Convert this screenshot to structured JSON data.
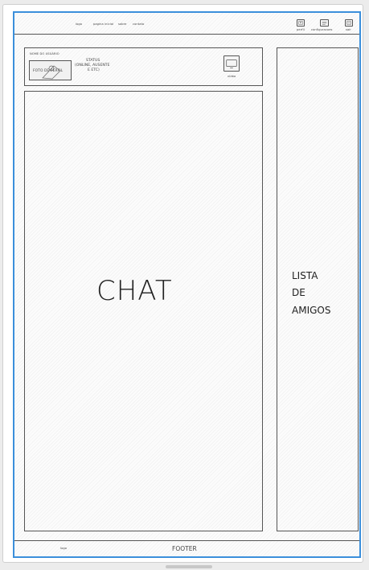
{
  "header": {
    "nav": [
      "logo",
      "pagina inicial",
      "sobre",
      "contato"
    ],
    "actions": [
      {
        "label": "perfil",
        "icon": "profile-icon"
      },
      {
        "label": "configuracoes",
        "icon": "settings-icon"
      },
      {
        "label": "sair",
        "icon": "logout-icon"
      }
    ]
  },
  "profile": {
    "username_label": "NOME DO USUÁRIO",
    "photo_label": "FOTO DE PERFIL",
    "status_line1": "STATUS",
    "status_line2": "(ONLINE, AUSENTE",
    "status_line3": "E ETC)",
    "video_label": "vídeo",
    "video_icon": "video-icon"
  },
  "chat": {
    "label": "CHAT"
  },
  "friends": {
    "line1": "LISTA",
    "line2": "DE",
    "line3": "AMIGOS"
  },
  "footer": {
    "logo": "logo",
    "label": "FOOTER"
  },
  "colors": {
    "selection": "#3b8fdb",
    "ink": "#222222"
  }
}
